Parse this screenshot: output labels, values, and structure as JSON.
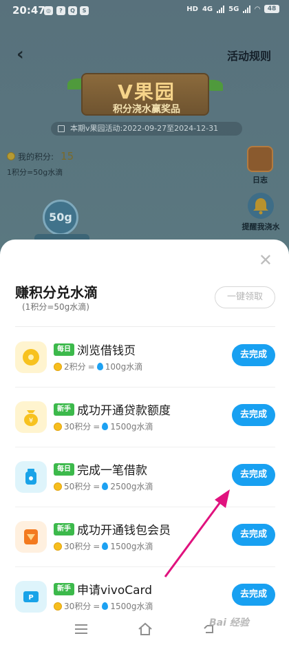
{
  "status_bar": {
    "time": "20:47",
    "hd_label": "HD",
    "net1": "4G",
    "net2": "5G",
    "battery": "48"
  },
  "background": {
    "rules_link": "活动规则",
    "sign_title": "V果园",
    "sign_subtitle": "积分浇水赢奖品",
    "period": "本期v果园活动:2022-09-27至2024-12-31",
    "points_label": "我的积分:",
    "points_value": "15",
    "points_rate": "1积分=50g水滴",
    "log_label": "日志",
    "remind_label": "提醒我浇水",
    "drop_amount": "50g"
  },
  "sheet": {
    "title": "赚积分兑水滴",
    "subtitle": "(1积分=50g水滴)",
    "claim_all": "一键领取",
    "tasks": [
      {
        "badge": "每日",
        "title": "浏览借钱页",
        "points": "2积分",
        "equals": "=",
        "water": "100g水滴",
        "button": "去完成",
        "icon": "coin-icon",
        "icon_color": "#f7c21f"
      },
      {
        "badge": "新手",
        "title": "成功开通贷款额度",
        "points": "30积分",
        "equals": "=",
        "water": "1500g水滴",
        "button": "去完成",
        "icon": "money-bag-icon",
        "icon_color": "#f7c21f"
      },
      {
        "badge": "每日",
        "title": "完成一笔借款",
        "points": "50积分",
        "equals": "=",
        "water": "2500g水滴",
        "button": "去完成",
        "icon": "jar-icon",
        "icon_color": "#1aa3e8"
      },
      {
        "badge": "新手",
        "title": "成功开通钱包会员",
        "points": "30积分",
        "equals": "=",
        "water": "1500g水滴",
        "button": "去完成",
        "icon": "vip-diamond-icon",
        "icon_color": "#f37a1f"
      },
      {
        "badge": "新手",
        "title": "申请vivoCard",
        "points": "30积分",
        "equals": "=",
        "water": "1500g水滴",
        "button": "去完成",
        "icon": "card-icon",
        "icon_color": "#1aa3e8"
      }
    ]
  },
  "watermark": "Bai 经验",
  "colors": {
    "accent_blue": "#18a0f1",
    "badge_green": "#3cb94b",
    "arrow_magenta": "#e0127e"
  }
}
